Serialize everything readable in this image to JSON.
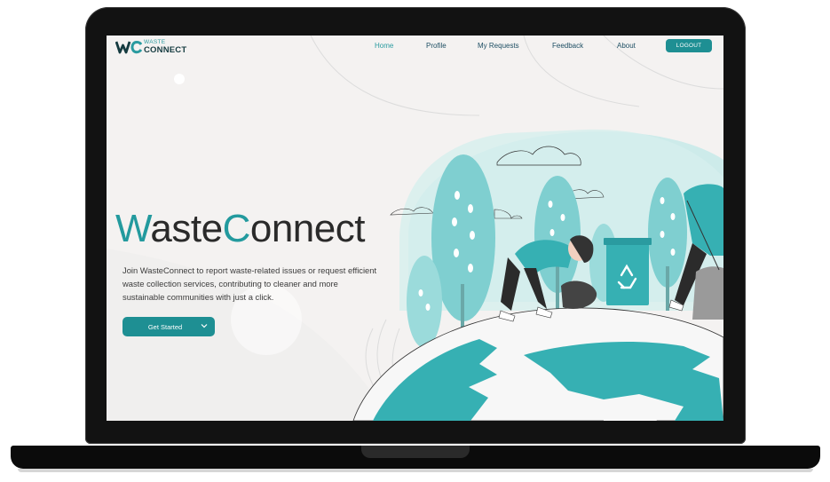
{
  "nav": {
    "logo_top": "WASTE",
    "logo_bottom": "CONNECT",
    "items": [
      {
        "label": "Home",
        "active": true
      },
      {
        "label": "Profile"
      },
      {
        "label": "My Requests"
      },
      {
        "label": "Feedback"
      },
      {
        "label": "About"
      }
    ],
    "logout_label": "LOGOUT"
  },
  "hero": {
    "title_w": "W",
    "title_aste": "aste",
    "title_c": "C",
    "title_onnect": "onnect",
    "description": "Join WasteConnect to report waste-related issues or request efficient waste collection services, contributing to cleaner and more sustainable communities with just a click.",
    "cta_label": "Get Started"
  },
  "icons": [
    "chevron-down-icon",
    "recycle-icon"
  ],
  "colors": {
    "accent": "#239a9e",
    "button": "#1e8f93",
    "nav_text": "#1d4e63",
    "illustration_light": "#a9dede",
    "illustration_dark": "#36b0b3"
  }
}
